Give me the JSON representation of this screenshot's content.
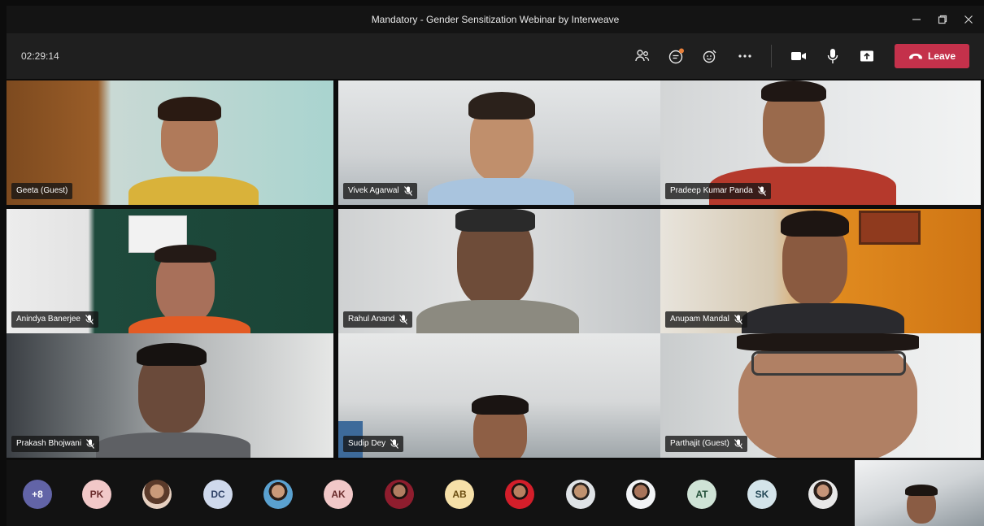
{
  "window": {
    "title": "Mandatory - Gender Sensitization Webinar by Interweave",
    "minimize_icon": "minimize-icon",
    "maximize_icon": "restore-icon",
    "close_icon": "close-icon"
  },
  "toolbar": {
    "timer": "02:29:14",
    "leave_label": "Leave",
    "leave_color": "#c4314b"
  },
  "participants": [
    {
      "name": "Geeta (Guest)",
      "muted": false
    },
    {
      "name": "Vivek Agarwal",
      "muted": true
    },
    {
      "name": "Pradeep Kumar Panda",
      "muted": true
    },
    {
      "name": "Anindya Banerjee",
      "muted": true
    },
    {
      "name": "Rahul Anand",
      "muted": true
    },
    {
      "name": "Anupam Mandal",
      "muted": true
    },
    {
      "name": "Prakash Bhojwani",
      "muted": true
    },
    {
      "name": "Sudip Dey",
      "muted": true
    },
    {
      "name": "Parthajit (Guest)",
      "muted": true
    }
  ],
  "overflow": {
    "more_count": "+8",
    "avatars": [
      {
        "initials": "PK",
        "bg": "#f1c8c8",
        "fg": "#6b2d2d"
      },
      {
        "initials": "",
        "photo": true
      },
      {
        "initials": "DC",
        "bg": "#cfd9ec",
        "fg": "#2c3e63"
      },
      {
        "initials": "",
        "photo": true
      },
      {
        "initials": "AK",
        "bg": "#f1c8c8",
        "fg": "#6b2d2d"
      },
      {
        "initials": "",
        "photo": true
      },
      {
        "initials": "AB",
        "bg": "#f6e0a8",
        "fg": "#6b4e12"
      },
      {
        "initials": "",
        "photo": true
      },
      {
        "initials": "",
        "photo": true
      },
      {
        "initials": "",
        "photo": true
      },
      {
        "initials": "AT",
        "bg": "#cfe3d6",
        "fg": "#24513a"
      },
      {
        "initials": "SK",
        "bg": "#d4e4ea",
        "fg": "#234756"
      },
      {
        "initials": "",
        "photo": true
      }
    ]
  }
}
